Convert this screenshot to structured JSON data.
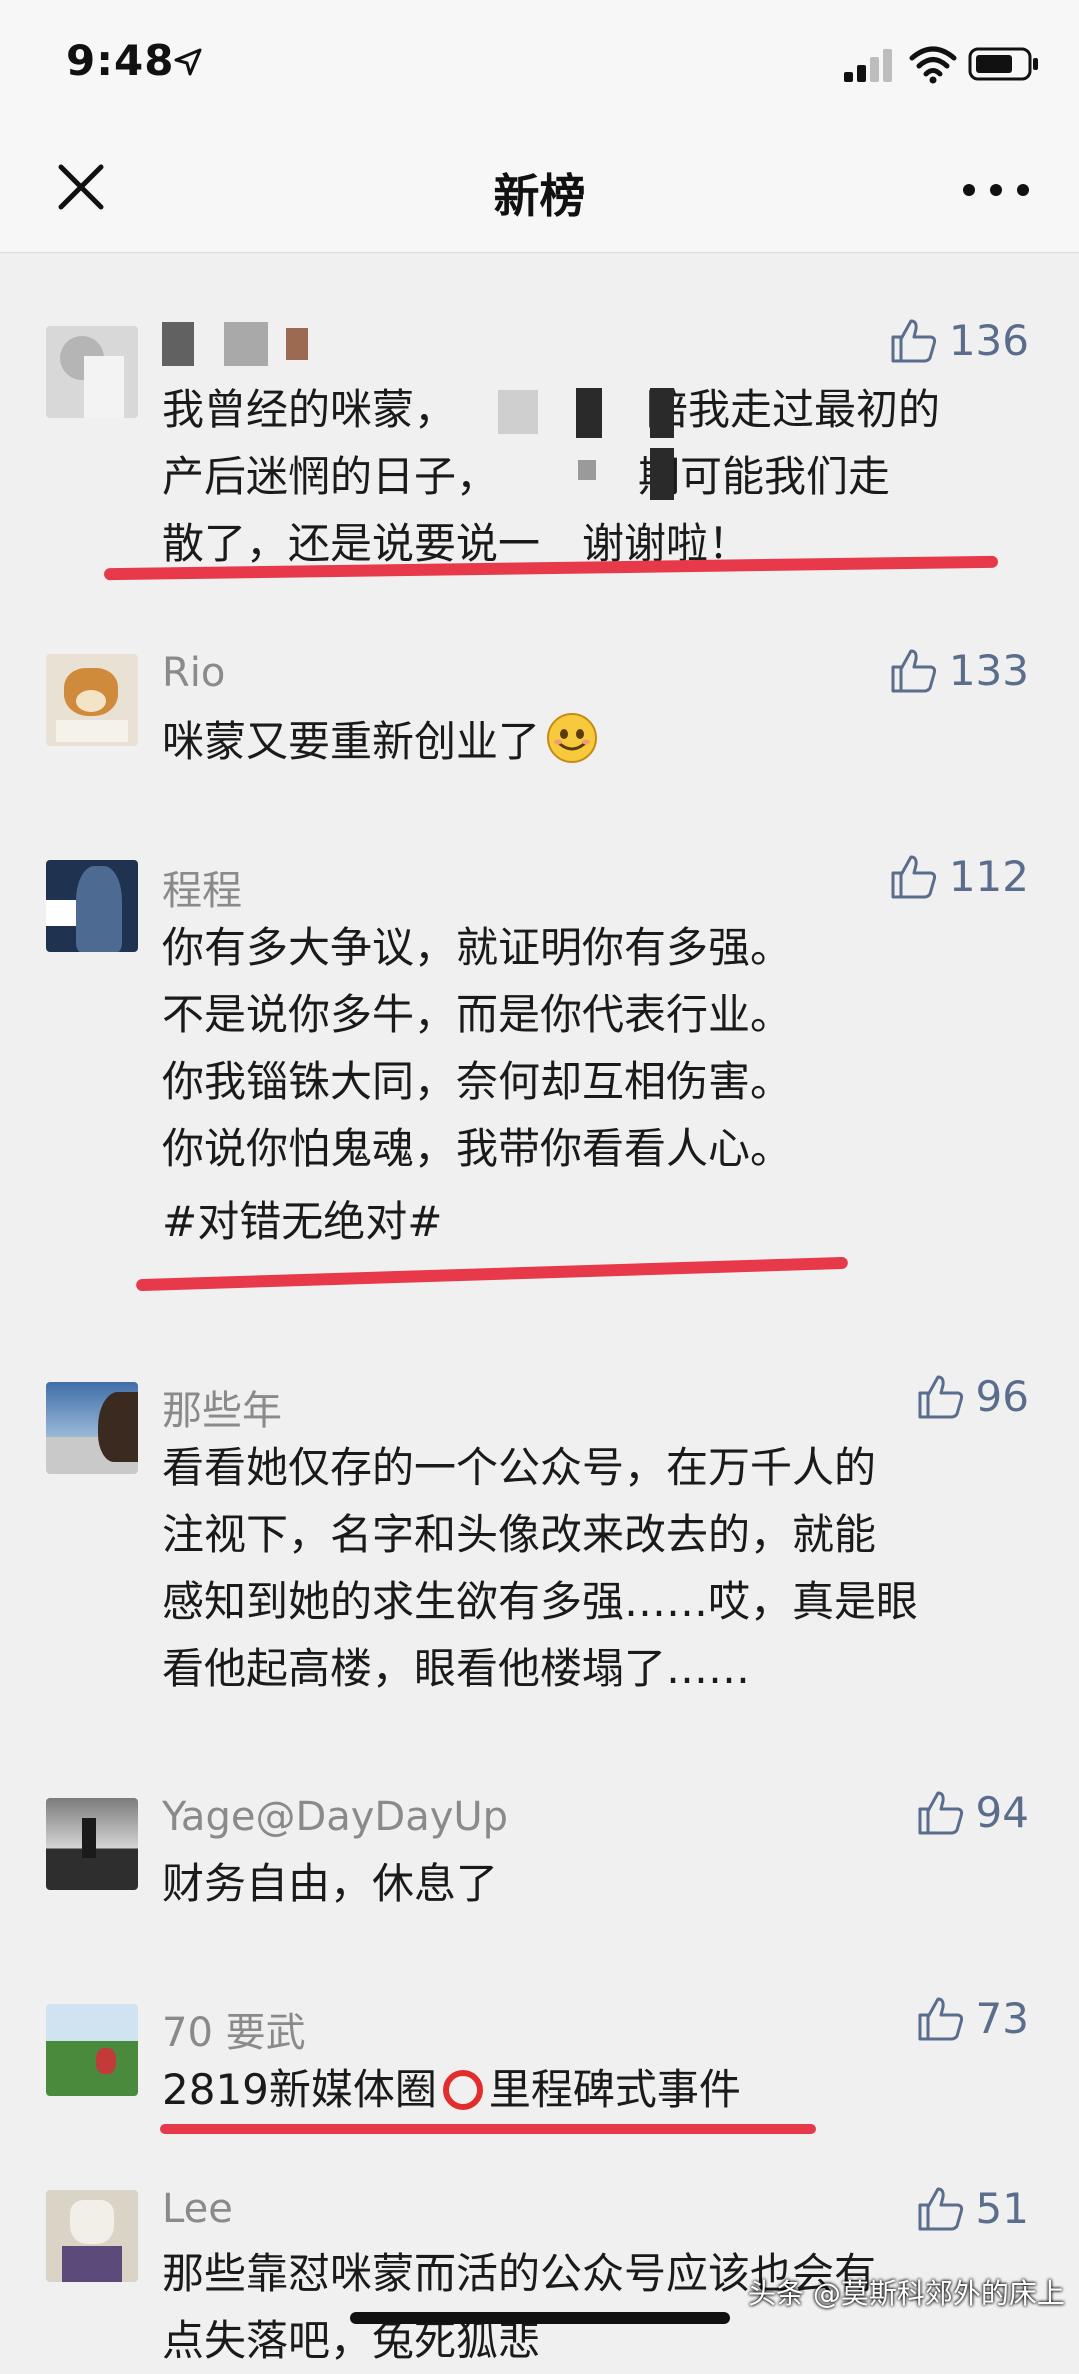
{
  "status_bar": {
    "time": "9:48"
  },
  "nav": {
    "title": "新榜"
  },
  "comments": [
    {
      "username": "",
      "likes": "136",
      "lines": [
        "我曾经的咪蒙，",
        "陪我走过最初的",
        "产后迷惘的日子，",
        "期可能我们走",
        "散了，还是说要说一",
        "谢谢啦！"
      ]
    },
    {
      "username": "Rio",
      "likes": "133",
      "lines": [
        "咪蒙又要重新创业了"
      ]
    },
    {
      "username": "程程",
      "likes": "112",
      "lines": [
        "你有多大争议，就证明你有多强。",
        "不是说你多牛，而是你代表行业。",
        "你我锱铢大同，奈何却互相伤害。",
        "你说你怕鬼魂，我带你看看人心。"
      ],
      "tag": "#对错无绝对#"
    },
    {
      "username": "那些年",
      "likes": "96",
      "lines": [
        "看看她仅存的一个公众号，在万千人的",
        "注视下，名字和头像改来改去的，就能",
        "感知到她的求生欲有多强……哎，真是眼",
        "看他起高楼，眼看他楼塌了……"
      ]
    },
    {
      "username": "Yage@DayDayUp",
      "likes": "94",
      "lines": [
        "财务自由，休息了"
      ]
    },
    {
      "username": "70 要武",
      "likes": "73",
      "lines": [
        "2819新媒体圈",
        "里程碑式事件"
      ]
    },
    {
      "username": "Lee",
      "likes": "51",
      "lines": [
        "那些靠怼咪蒙而活的公众号应该也会有",
        "点失落吧，兔死狐悲"
      ]
    }
  ],
  "watermark": "头条 @莫斯科郊外的床上",
  "colors": {
    "underline": "#e8394b",
    "like": "#5a6d8c",
    "username": "#8a8a8a"
  }
}
